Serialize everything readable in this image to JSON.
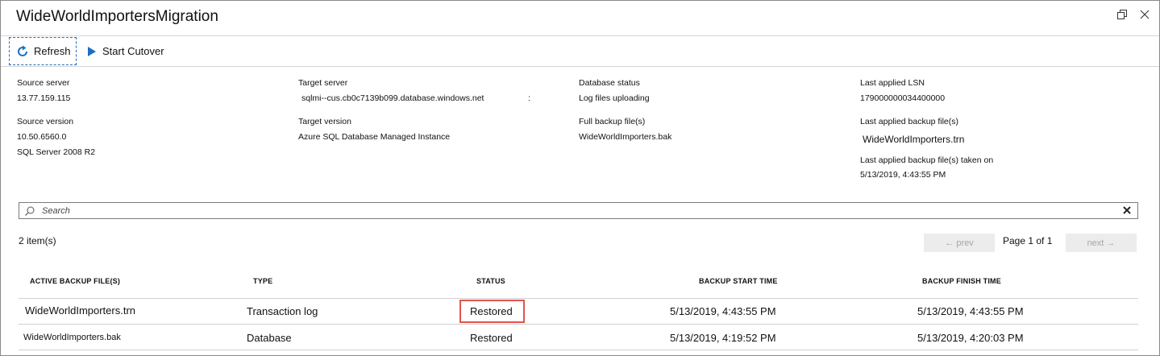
{
  "window": {
    "title": "WideWorldImportersMigration"
  },
  "toolbar": {
    "refresh_label": "Refresh",
    "cutover_label": "Start Cutover"
  },
  "properties": {
    "source_server_label": "Source server",
    "source_server_value": "13.77.159.115",
    "source_version_label": "Source version",
    "source_version_value": "10.50.6560.0",
    "source_version_product": "SQL Server 2008 R2",
    "target_server_label": "Target server",
    "target_server_value": "sqlmi--cus.cb0c7139b099.database.windows.net",
    "target_server_suffix": ":",
    "target_version_label": "Target version",
    "target_version_value": "Azure SQL Database Managed Instance",
    "db_status_label": "Database status",
    "db_status_value": "Log files uploading",
    "full_backup_label": "Full backup file(s)",
    "full_backup_value": "WideWorldImporters.bak",
    "last_lsn_label": "Last applied LSN",
    "last_lsn_value": "179000000034400000",
    "last_backup_label": "Last applied backup file(s)",
    "last_backup_value": "WideWorldImporters.trn",
    "last_backup_taken_label": "Last applied backup file(s) taken on",
    "last_backup_taken_value": "5/13/2019, 4:43:55 PM"
  },
  "search": {
    "placeholder": "Search"
  },
  "list": {
    "count": "2 item(s)",
    "prev_label": "← prev",
    "next_label": "next →",
    "page_info": "Page 1 of 1",
    "columns": [
      "ACTIVE BACKUP FILE(S)",
      "TYPE",
      "STATUS",
      "BACKUP START TIME",
      "BACKUP FINISH TIME"
    ],
    "rows": [
      {
        "file": "WideWorldImporters.trn",
        "type": "Transaction log",
        "status": "Restored",
        "start": "5/13/2019, 4:43:55 PM",
        "finish": "5/13/2019, 4:43:55 PM"
      },
      {
        "file": "WideWorldImporters.bak",
        "type": "Database",
        "status": "Restored",
        "start": "5/13/2019, 4:19:52 PM",
        "finish": "5/13/2019, 4:20:03 PM"
      }
    ]
  },
  "colors": {
    "accent": "#1b6fc2",
    "highlight": "#e0534f",
    "disabled_bg": "#ececec"
  }
}
